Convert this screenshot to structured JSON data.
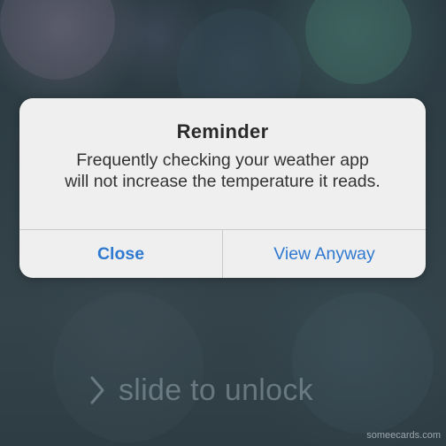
{
  "alert": {
    "title": "Reminder",
    "message": "Frequently checking your weather app will not increase the temperature it reads.",
    "buttons": {
      "close_label": "Close",
      "view_anyway_label": "View Anyway"
    },
    "button_color": "#2f7ad0"
  },
  "lockscreen": {
    "unlock_label": "slide to unlock",
    "chevron_icon": "chevron-right-icon"
  },
  "watermark": "someecards.com"
}
